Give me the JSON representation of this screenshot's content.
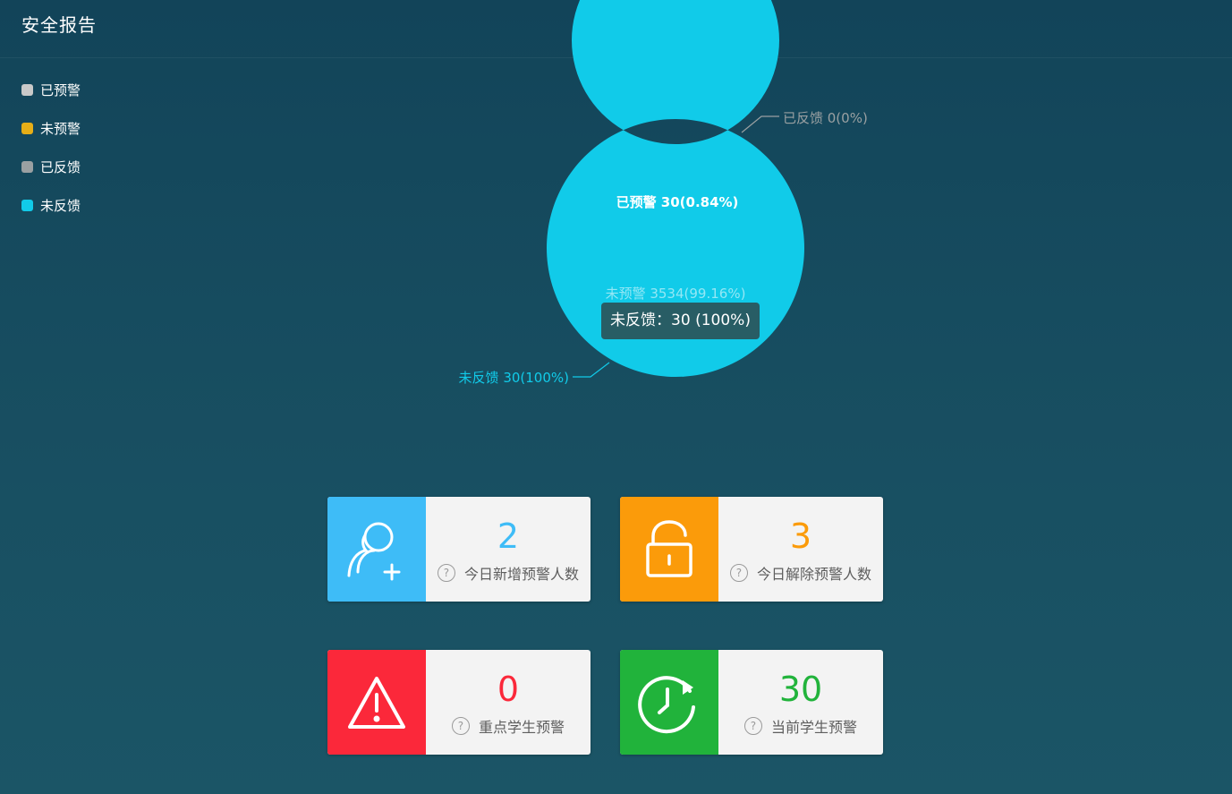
{
  "page": {
    "title": "安全报告"
  },
  "colors": {
    "alerted": "#c9c9c9",
    "not_alerted": "#e6ae17",
    "fed_back": "#9aa0a2",
    "not_fed_back": "#11cbe9",
    "card_blue": "#3ebcf7",
    "card_orange": "#fb9b0a",
    "card_red": "#fb283a",
    "card_green": "#21b33b"
  },
  "legend": [
    {
      "label": "已预警",
      "color": "#c9c9c9"
    },
    {
      "label": "未预警",
      "color": "#e6ae17"
    },
    {
      "label": "已反馈",
      "color": "#9aa0a2"
    },
    {
      "label": "未反馈",
      "color": "#11cbe9"
    }
  ],
  "chart_data": {
    "type": "pie",
    "inner_series": [
      {
        "name": "已预警",
        "value": 30,
        "percent": "0.84%",
        "label": "已预警 30(0.84%)"
      },
      {
        "name": "未预警",
        "value": 3534,
        "percent": "99.16%",
        "label": "未预警 3534(99.16%)"
      }
    ],
    "outer_series": [
      {
        "name": "已反馈",
        "value": 0,
        "percent": "0%",
        "label": "已反馈 0(0%)"
      },
      {
        "name": "未反馈",
        "value": 30,
        "percent": "100%",
        "label": "未反馈 30(100%)"
      }
    ],
    "legend_position": "top-left"
  },
  "tooltip": {
    "text": "未反馈：30 (100%)"
  },
  "cards": [
    {
      "value": "2",
      "label": "今日新增预警人数",
      "icon": "user-add-icon",
      "color": "#3ebcf7"
    },
    {
      "value": "3",
      "label": "今日解除预警人数",
      "icon": "unlock-icon",
      "color": "#fb9b0a"
    },
    {
      "value": "0",
      "label": "重点学生预警",
      "icon": "warning-icon",
      "color": "#fb283a"
    },
    {
      "value": "30",
      "label": "当前学生预警",
      "icon": "clock-refresh-icon",
      "color": "#21b33b"
    }
  ]
}
